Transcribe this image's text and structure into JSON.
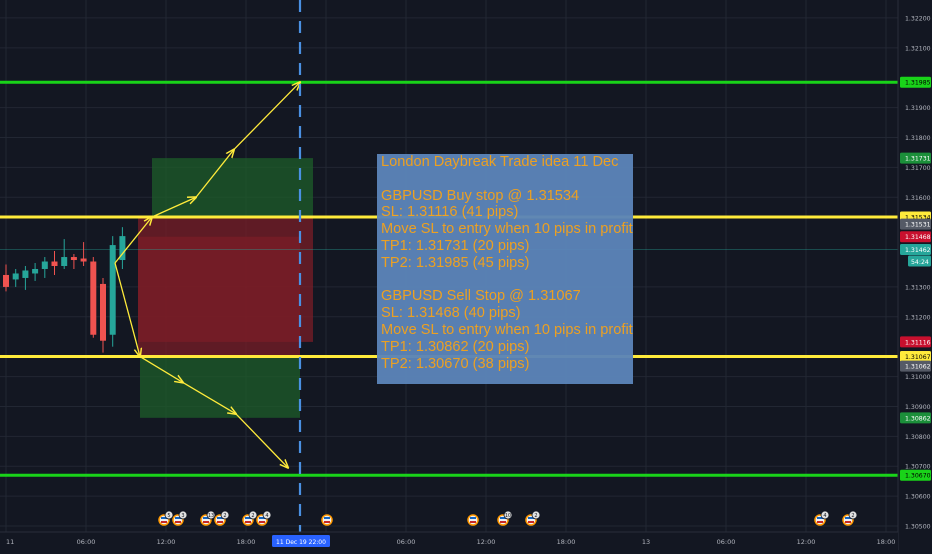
{
  "chart_data": {
    "type": "candlestick",
    "y_axis": {
      "range": [
        1.3048,
        1.3226
      ],
      "ticks": [
        "1.32200",
        "1.32100",
        "1.31900",
        "1.31800",
        "1.31700",
        "1.31600",
        "1.31300",
        "1.31200",
        "1.31000",
        "1.30900",
        "1.30800",
        "1.30700",
        "1.30600",
        "1.30500"
      ],
      "tick_values": [
        1.322,
        1.321,
        1.319,
        1.318,
        1.317,
        1.316,
        1.313,
        1.312,
        1.31,
        1.309,
        1.308,
        1.307,
        1.306,
        1.305
      ]
    },
    "x_axis": {
      "ticks": [
        "11",
        "06:00",
        "12:00",
        "18:00",
        "2",
        "06:00",
        "12:00",
        "18:00",
        "13",
        "06:00",
        "12:00",
        "18:00"
      ],
      "cursor_label": "11 Dec 19   22:00"
    },
    "grid": true,
    "candles": [
      {
        "o": 1.3134,
        "h": 1.31375,
        "l": 1.31285,
        "c": 1.313
      },
      {
        "o": 1.31325,
        "h": 1.3136,
        "l": 1.313,
        "c": 1.31345
      },
      {
        "o": 1.3133,
        "h": 1.3137,
        "l": 1.3129,
        "c": 1.31355
      },
      {
        "o": 1.31345,
        "h": 1.3138,
        "l": 1.3132,
        "c": 1.3136
      },
      {
        "o": 1.3136,
        "h": 1.314,
        "l": 1.3133,
        "c": 1.31385
      },
      {
        "o": 1.31385,
        "h": 1.3142,
        "l": 1.3134,
        "c": 1.3137
      },
      {
        "o": 1.3137,
        "h": 1.3146,
        "l": 1.3136,
        "c": 1.314
      },
      {
        "o": 1.314,
        "h": 1.3141,
        "l": 1.3136,
        "c": 1.3139
      },
      {
        "o": 1.31395,
        "h": 1.3145,
        "l": 1.3137,
        "c": 1.31385
      },
      {
        "o": 1.31385,
        "h": 1.314,
        "l": 1.3113,
        "c": 1.3114
      },
      {
        "o": 1.3131,
        "h": 1.3133,
        "l": 1.3108,
        "c": 1.3112
      },
      {
        "o": 1.3114,
        "h": 1.3147,
        "l": 1.311,
        "c": 1.3144
      },
      {
        "o": 1.3139,
        "h": 1.315,
        "l": 1.3136,
        "c": 1.3147
      }
    ],
    "price_lines": [
      {
        "name": "tp2-buy",
        "value": 1.31985,
        "color": "#19d319",
        "label": "1.31985"
      },
      {
        "name": "buy-stop",
        "value": 1.31534,
        "color": "#ffeb3b",
        "label": "1.31534"
      },
      {
        "name": "sell-stop",
        "value": 1.31067,
        "color": "#ffeb3b",
        "label": "1.31067"
      },
      {
        "name": "tp2-sell",
        "value": 1.3067,
        "color": "#19d319",
        "label": "1.30670"
      }
    ],
    "price_labels": [
      {
        "value": 1.31985,
        "label": "1.31985",
        "bg": "#19d319",
        "fg": "#000000"
      },
      {
        "value": 1.31731,
        "label": "1.31731",
        "bg": "#1b8f3a",
        "fg": "#ffffff"
      },
      {
        "value": 1.31534,
        "label": "1.31534",
        "bg": "#ffeb3b",
        "fg": "#000000"
      },
      {
        "value": 1.3151,
        "label": "1.31531",
        "bg": "#555a66",
        "fg": "#ffffff"
      },
      {
        "value": 1.31468,
        "label": "1.31468",
        "bg": "#c8102e",
        "fg": "#ffffff"
      },
      {
        "value": 1.31425,
        "label": "1.31462",
        "bg": "#26a69a",
        "fg": "#ffffff"
      },
      {
        "value": 1.31116,
        "label": "1.31116",
        "bg": "#c8102e",
        "fg": "#ffffff"
      },
      {
        "value": 1.31067,
        "label": "1.31067",
        "bg": "#ffeb3b",
        "fg": "#000000"
      },
      {
        "value": 1.31035,
        "label": "1.31062",
        "bg": "#555a66",
        "fg": "#ffffff"
      },
      {
        "value": 1.30862,
        "label": "1.30862",
        "bg": "#1b8f3a",
        "fg": "#ffffff"
      },
      {
        "value": 1.3067,
        "label": "1.30670",
        "bg": "#19d319",
        "fg": "#000000"
      }
    ],
    "countdown_label": "54:24",
    "zones": [
      {
        "name": "buy-profit-zone",
        "y1": 1.31731,
        "y2": 1.31534,
        "color": "#1e5e2a"
      },
      {
        "name": "buy-loss-zone",
        "y1": 1.31534,
        "y2": 1.31116,
        "color": "#7a1d27"
      },
      {
        "name": "sell-loss-zone",
        "y1": 1.31468,
        "y2": 1.31067,
        "color": "#7a1d27"
      },
      {
        "name": "sell-profit-zone",
        "y1": 1.31067,
        "y2": 1.30862,
        "color": "#1e5e2a"
      }
    ],
    "colors": {
      "up": "#26a69a",
      "down": "#ef5350",
      "arrow": "#ffeb3b",
      "cursor": "#4a90e2"
    },
    "annotation": {
      "lines": [
        "London Daybreak Trade idea 11 Dec",
        "",
        "GBPUSD Buy stop @ 1.31534",
        "SL: 1.31116 (41 pips)",
        "Move SL to entry when 10 pips in profit",
        "TP1: 1.31731 (20 pips)",
        "TP2: 1.31985 (45 pips)",
        "",
        "GBPUSD Sell Stop @ 1.31067",
        "SL: 1.31468 (40 pips)",
        "Move SL to entry when 10 pips in profit",
        "TP1: 1.30862 (20 pips)",
        "TP2: 1.30670 (38 pips)"
      ]
    },
    "event_markers": [
      {
        "label": "5"
      },
      {
        "label": "3"
      },
      {
        "label": "13"
      },
      {
        "label": "2"
      },
      {
        "label": "2"
      },
      {
        "label": "4"
      },
      {
        "label": ""
      },
      {
        "label": ""
      },
      {
        "label": "10"
      },
      {
        "label": "2"
      },
      {
        "label": "4"
      },
      {
        "label": "2"
      }
    ]
  }
}
